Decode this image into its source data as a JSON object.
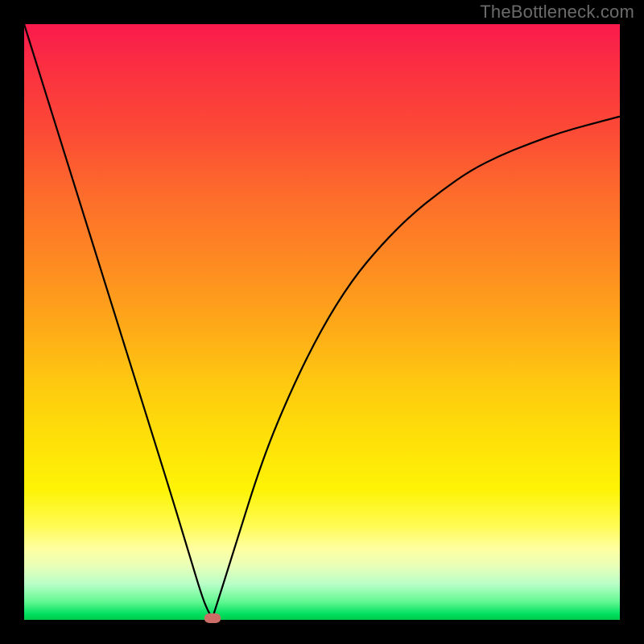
{
  "watermark": "TheBottleneck.com",
  "chart_data": {
    "type": "line",
    "title": "",
    "xlabel": "",
    "ylabel": "",
    "xlim": [
      0,
      100
    ],
    "ylim": [
      0,
      100
    ],
    "grid": false,
    "legend": false,
    "series": [
      {
        "name": "bottleneck-curve",
        "x": [
          0,
          5,
          10,
          15,
          20,
          25,
          28,
          30,
          31,
          31.6,
          32,
          35,
          40,
          45,
          50,
          55,
          60,
          65,
          70,
          75,
          80,
          85,
          90,
          95,
          100
        ],
        "y": [
          100,
          84,
          68,
          52,
          36,
          20,
          10,
          3.5,
          1.2,
          0.3,
          1.5,
          11,
          27,
          39,
          49,
          57,
          63,
          68,
          72,
          75.5,
          78,
          80,
          81.8,
          83.2,
          84.5
        ]
      }
    ],
    "annotations": [
      {
        "name": "optimal-point",
        "x": 31.6,
        "y": 0.3
      }
    ],
    "background_gradient": {
      "top": "#fa1a4d",
      "mid_upper": "#fe8a22",
      "mid": "#fee108",
      "mid_lower": "#fffb50",
      "bottom": "#00c94a"
    }
  }
}
